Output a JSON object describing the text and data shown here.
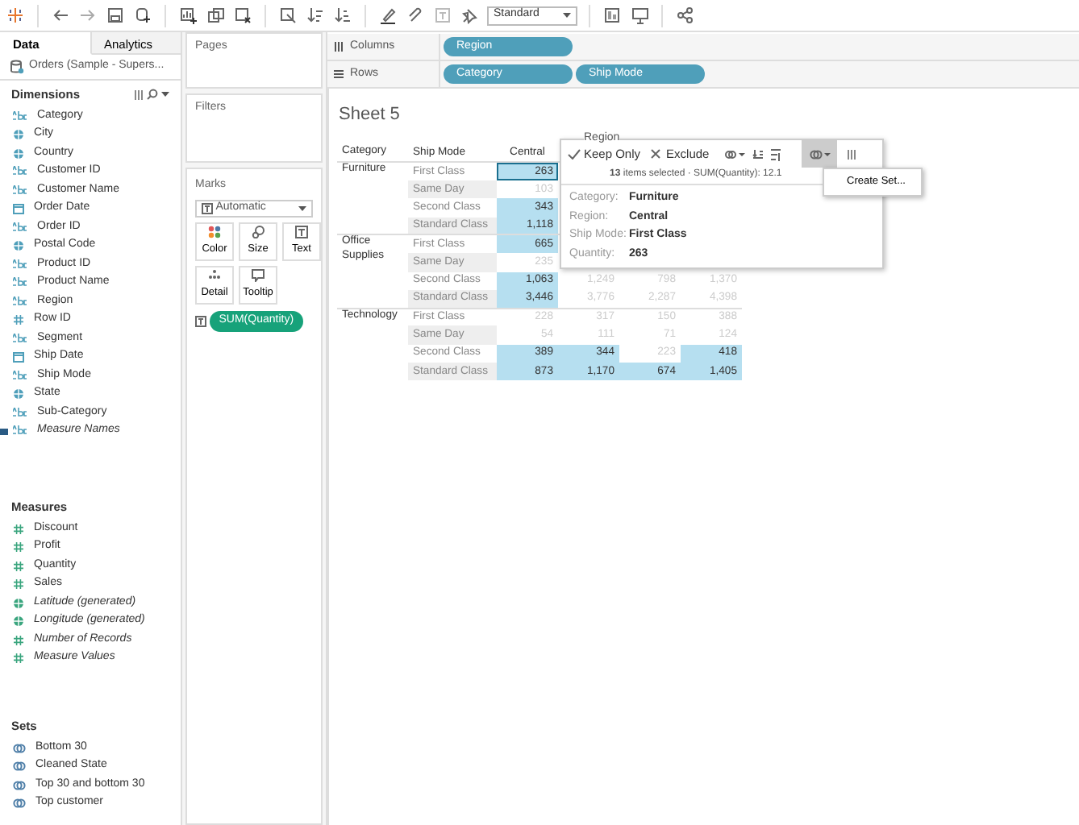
{
  "toolbar": {
    "view_size": "Standard"
  },
  "data_pane": {
    "tabs": [
      {
        "label": "Data",
        "selected": true
      },
      {
        "label": "Analytics",
        "selected": false
      }
    ],
    "datasource": "Orders (Sample - Supers...",
    "dimensions": {
      "title": "Dimensions",
      "fields": [
        {
          "name": "Category",
          "kind": "string",
          "italic": false
        },
        {
          "name": "City",
          "kind": "geo",
          "italic": false
        },
        {
          "name": "Country",
          "kind": "geo",
          "italic": false
        },
        {
          "name": "Customer ID",
          "kind": "string",
          "italic": false
        },
        {
          "name": "Customer Name",
          "kind": "string",
          "italic": false
        },
        {
          "name": "Order Date",
          "kind": "date",
          "italic": false
        },
        {
          "name": "Order ID",
          "kind": "string",
          "italic": false
        },
        {
          "name": "Postal Code",
          "kind": "geo",
          "italic": false
        },
        {
          "name": "Product ID",
          "kind": "string",
          "italic": false
        },
        {
          "name": "Product Name",
          "kind": "string",
          "italic": false
        },
        {
          "name": "Region",
          "kind": "string",
          "italic": false
        },
        {
          "name": "Row ID",
          "kind": "number",
          "italic": false
        },
        {
          "name": "Segment",
          "kind": "string",
          "italic": false
        },
        {
          "name": "Ship Date",
          "kind": "date",
          "italic": false
        },
        {
          "name": "Ship Mode",
          "kind": "string",
          "italic": false
        },
        {
          "name": "State",
          "kind": "geo",
          "italic": false
        },
        {
          "name": "Sub-Category",
          "kind": "string",
          "italic": false
        },
        {
          "name": "Measure Names",
          "kind": "string",
          "italic": true
        }
      ]
    },
    "measures": {
      "title": "Measures",
      "fields": [
        {
          "name": "Discount",
          "kind": "number",
          "italic": false
        },
        {
          "name": "Profit",
          "kind": "number",
          "italic": false
        },
        {
          "name": "Quantity",
          "kind": "number",
          "italic": false
        },
        {
          "name": "Sales",
          "kind": "number",
          "italic": false
        },
        {
          "name": "Latitude (generated)",
          "kind": "geo",
          "italic": true
        },
        {
          "name": "Longitude (generated)",
          "kind": "geo",
          "italic": true
        },
        {
          "name": "Number of Records",
          "kind": "number",
          "italic": true
        },
        {
          "name": "Measure Values",
          "kind": "number",
          "italic": true
        }
      ]
    },
    "sets": {
      "title": "Sets",
      "fields": [
        {
          "name": "Bottom 30",
          "kind": "set",
          "italic": false
        },
        {
          "name": "Cleaned State",
          "kind": "set",
          "italic": false
        },
        {
          "name": "Top 30 and bottom 30",
          "kind": "set",
          "italic": false
        },
        {
          "name": "Top customer",
          "kind": "set",
          "italic": false
        }
      ]
    }
  },
  "pages": {
    "title": "Pages"
  },
  "filters": {
    "title": "Filters"
  },
  "marks": {
    "title": "Marks",
    "mark_type": "Automatic",
    "buttons": [
      {
        "label": "Color",
        "kind": "color"
      },
      {
        "label": "Size",
        "kind": "size"
      },
      {
        "label": "Text",
        "kind": "text"
      },
      {
        "label": "Detail",
        "kind": "detail"
      },
      {
        "label": "Tooltip",
        "kind": "tooltip"
      }
    ],
    "pill": "SUM(Quantity)"
  },
  "shelves": [
    {
      "label": "Columns",
      "kind": "columns",
      "pills": [
        "Region"
      ]
    },
    {
      "label": "Rows",
      "kind": "rows",
      "pills": [
        "Category",
        "Ship Mode"
      ]
    }
  ],
  "sheet": {
    "title": "Sheet 5",
    "column_group": "Region",
    "headers": [
      "Category",
      "Ship Mode",
      "Central"
    ],
    "groups": [
      {
        "category": "Furniture",
        "rows": [
          {
            "ship_mode": "First Class",
            "cells": [
              {
                "text": "263",
                "selected": true,
                "focused": true
              }
            ]
          },
          {
            "ship_mode": "Same Day",
            "cells": [
              {
                "text": "103",
                "selected": false,
                "focused": false
              }
            ]
          },
          {
            "ship_mode": "Second Class",
            "cells": [
              {
                "text": "343",
                "selected": true,
                "focused": false
              }
            ]
          },
          {
            "ship_mode": "Standard Class",
            "cells": [
              {
                "text": "1,118",
                "selected": true,
                "focused": false
              }
            ]
          }
        ]
      },
      {
        "category": "Office Supplies",
        "rows": [
          {
            "ship_mode": "First Class",
            "cells": [
              {
                "text": "665",
                "selected": true,
                "focused": false
              }
            ]
          },
          {
            "ship_mode": "Same Day",
            "cells": [
              {
                "text": "235",
                "selected": false,
                "focused": false
              }
            ]
          },
          {
            "ship_mode": "Second Class",
            "cells": [
              {
                "text": "1,063",
                "selected": true,
                "focused": false
              },
              {
                "text": "1,249",
                "selected": false,
                "focused": false
              },
              {
                "text": "798",
                "selected": false,
                "focused": false
              },
              {
                "text": "1,370",
                "selected": false,
                "focused": false
              }
            ]
          },
          {
            "ship_mode": "Standard Class",
            "cells": [
              {
                "text": "3,446",
                "selected": true,
                "focused": false
              },
              {
                "text": "3,776",
                "selected": false,
                "focused": false
              },
              {
                "text": "2,287",
                "selected": false,
                "focused": false
              },
              {
                "text": "4,398",
                "selected": false,
                "focused": false
              }
            ]
          }
        ]
      },
      {
        "category": "Technology",
        "rows": [
          {
            "ship_mode": "First Class",
            "cells": [
              {
                "text": "228",
                "selected": false,
                "focused": false
              },
              {
                "text": "317",
                "selected": false,
                "focused": false
              },
              {
                "text": "150",
                "selected": false,
                "focused": false
              },
              {
                "text": "388",
                "selected": false,
                "focused": false
              }
            ]
          },
          {
            "ship_mode": "Same Day",
            "cells": [
              {
                "text": "54",
                "selected": false,
                "focused": false
              },
              {
                "text": "111",
                "selected": false,
                "focused": false
              },
              {
                "text": "71",
                "selected": false,
                "focused": false
              },
              {
                "text": "124",
                "selected": false,
                "focused": false
              }
            ]
          },
          {
            "ship_mode": "Second Class",
            "cells": [
              {
                "text": "389",
                "selected": true,
                "focused": false
              },
              {
                "text": "344",
                "selected": true,
                "focused": false
              },
              {
                "text": "223",
                "selected": false,
                "focused": false
              },
              {
                "text": "418",
                "selected": true,
                "focused": false
              }
            ]
          },
          {
            "ship_mode": "Standard Class",
            "cells": [
              {
                "text": "873",
                "selected": true,
                "focused": false
              },
              {
                "text": "1,170",
                "selected": true,
                "focused": false
              },
              {
                "text": "674",
                "selected": true,
                "focused": false
              },
              {
                "text": "1,405",
                "selected": true,
                "focused": false
              }
            ]
          }
        ]
      }
    ]
  },
  "tooltip": {
    "actions": [
      {
        "label": "Keep Only",
        "kind": "keep"
      },
      {
        "label": "Exclude",
        "kind": "exclude"
      }
    ],
    "summary": "**13** items selected · SUM(Quantity): 12.1",
    "details": [
      {
        "label": "Category:",
        "value": "Furniture"
      },
      {
        "label": "Region:",
        "value": "Central"
      },
      {
        "label": "Ship Mode:",
        "value": "First Class"
      },
      {
        "label": "Quantity:",
        "value": "263"
      }
    ]
  },
  "menu": {
    "items": [
      "Create Set..."
    ]
  }
}
